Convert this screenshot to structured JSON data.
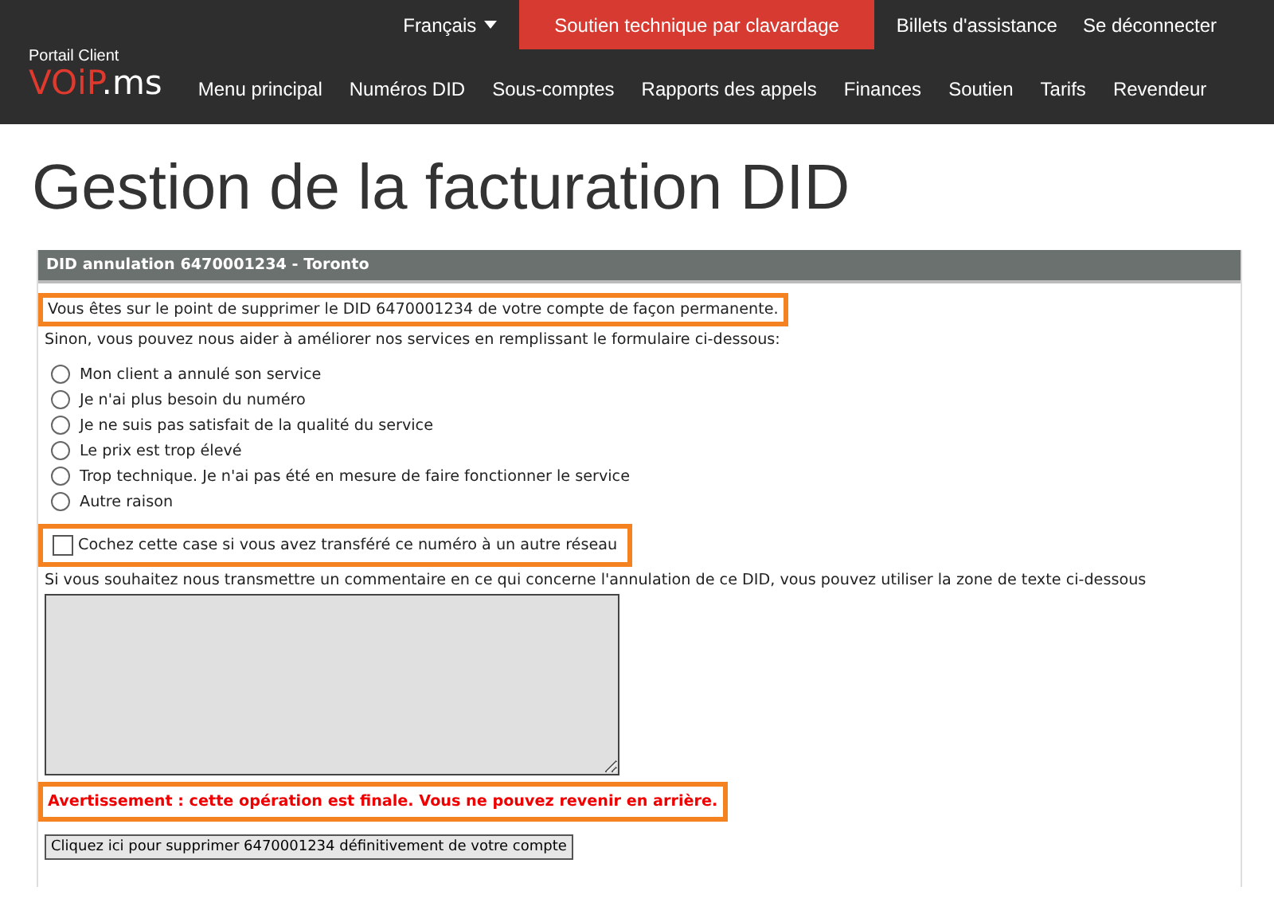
{
  "topbar": {
    "language": "Français",
    "chat_button": "Soutien technique par clavardage",
    "links": [
      "Billets d'assistance",
      "Se déconnecter"
    ]
  },
  "brand": {
    "caption": "Portail Client",
    "logo_main": "VOiP",
    "logo_suffix": ".ms"
  },
  "nav": [
    "Menu principal",
    "Numéros DID",
    "Sous-comptes",
    "Rapports des appels",
    "Finances",
    "Soutien",
    "Tarifs",
    "Revendeur"
  ],
  "page_title": "Gestion de la facturation DID",
  "panel": {
    "header": "DID annulation 6470001234 - Toronto",
    "notice": {
      "text": "Vous êtes sur le point de supprimer le DID 6470001234 de votre compte de façon permanente.",
      "highlighted": true
    },
    "intro": "Sinon, vous pouvez nous aider à améliorer nos services en remplissant le formulaire ci-dessous:",
    "reasons": [
      {
        "label": "Mon client a annulé son service",
        "selected": false
      },
      {
        "label": "Je n'ai plus besoin du numéro",
        "selected": false
      },
      {
        "label": "Je ne suis pas satisfait de la qualité du service",
        "selected": false
      },
      {
        "label": "Le prix est trop élevé",
        "selected": false
      },
      {
        "label": "Trop technique. Je n'ai pas été en mesure de faire fonctionner le service",
        "selected": false
      },
      {
        "label": "Autre raison",
        "selected": false
      }
    ],
    "transfer": {
      "label": "Cochez cette case si vous avez transféré ce numéro à un autre réseau",
      "checked": false,
      "highlighted": true
    },
    "comment_label": "Si vous souhaitez nous transmettre un commentaire en ce qui concerne l'annulation de ce DID, vous pouvez utiliser la zone de texte ci-dessous",
    "warning": {
      "text": "Avertissement : cette opération est finale. Vous ne pouvez revenir en arrière.",
      "highlighted": true
    },
    "submit": "Cliquez ici pour supprimer 6470001234 définitivement de votre compte"
  }
}
